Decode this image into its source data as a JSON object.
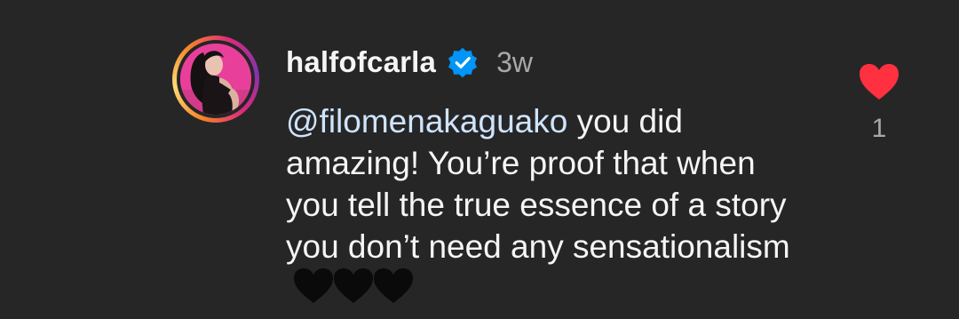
{
  "comment": {
    "username": "halfofcarla",
    "verified": true,
    "time_ago": "3w",
    "mention": "@filomenakaguako",
    "text": " you did amazing! You’re proof that when you tell the true essence of a story you don’t need any sensationalism",
    "emoji_count": 3,
    "like_count": "1",
    "liked": true
  },
  "colors": {
    "background": "#262626",
    "like_heart": "#ff3040",
    "verified_badge": "#0095f6",
    "muted_text": "#a8a8a8"
  },
  "icons": {
    "like": "heart-icon",
    "verified": "verified-badge-icon",
    "emoji": "black-heart-emoji"
  }
}
